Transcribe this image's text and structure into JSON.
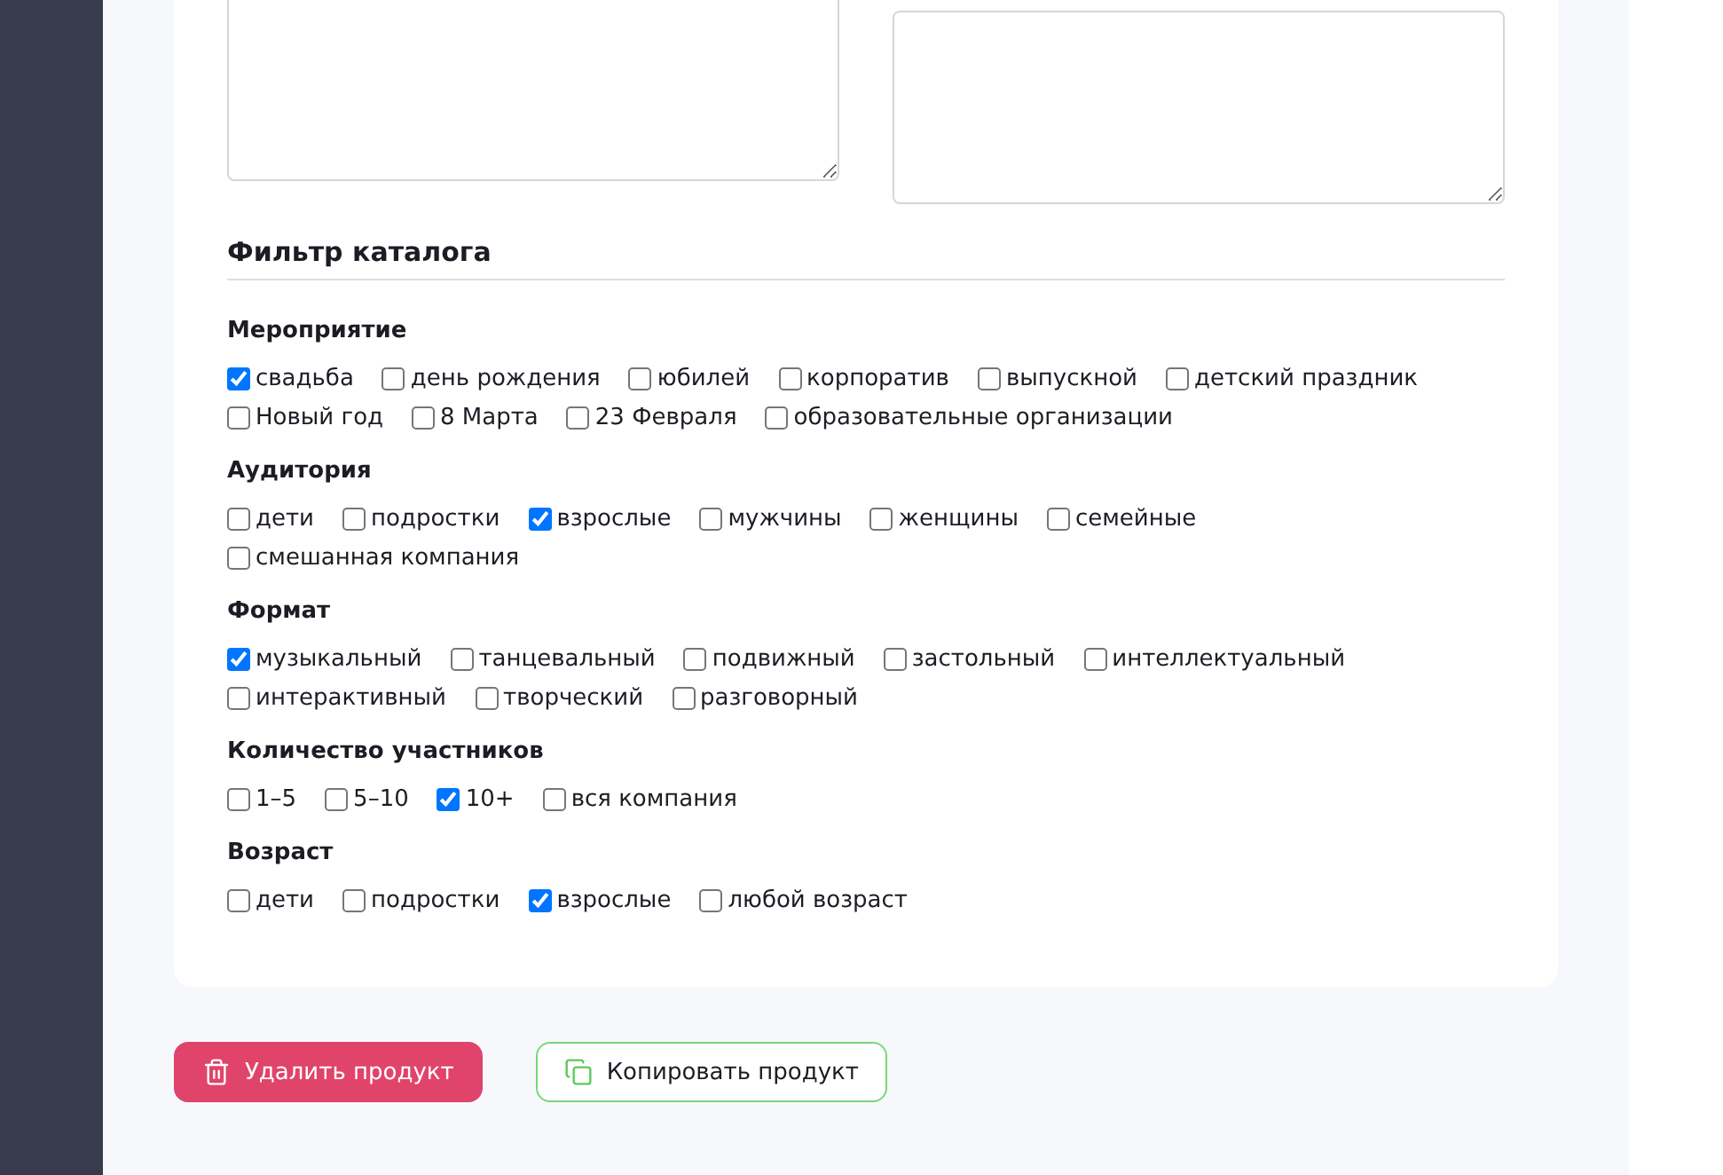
{
  "catalog_filter": {
    "title": "Фильтр каталога",
    "groups": [
      {
        "title": "Мероприятие",
        "options": [
          {
            "label": "свадьба",
            "checked": true
          },
          {
            "label": "день рождения",
            "checked": false
          },
          {
            "label": "юбилей",
            "checked": false
          },
          {
            "label": "корпоратив",
            "checked": false
          },
          {
            "label": "выпускной",
            "checked": false
          },
          {
            "label": "детский праздник",
            "checked": false
          },
          {
            "label": "Новый год",
            "checked": false
          },
          {
            "label": "8 Марта",
            "checked": false
          },
          {
            "label": "23 Февраля",
            "checked": false
          },
          {
            "label": "образовательные организации",
            "checked": false
          }
        ]
      },
      {
        "title": "Аудитория",
        "options": [
          {
            "label": "дети",
            "checked": false
          },
          {
            "label": "подростки",
            "checked": false
          },
          {
            "label": "взрослые",
            "checked": true
          },
          {
            "label": "мужчины",
            "checked": false
          },
          {
            "label": "женщины",
            "checked": false
          },
          {
            "label": "семейные",
            "checked": false
          },
          {
            "label": "смешанная компания",
            "checked": false
          }
        ]
      },
      {
        "title": "Формат",
        "options": [
          {
            "label": "музыкальный",
            "checked": true
          },
          {
            "label": "танцевальный",
            "checked": false
          },
          {
            "label": "подвижный",
            "checked": false
          },
          {
            "label": "застольный",
            "checked": false
          },
          {
            "label": "интеллектуальный",
            "checked": false
          },
          {
            "label": "интерактивный",
            "checked": false
          },
          {
            "label": "творческий",
            "checked": false
          },
          {
            "label": "разговорный",
            "checked": false
          }
        ]
      },
      {
        "title": "Количество участников",
        "options": [
          {
            "label": "1–5",
            "checked": false
          },
          {
            "label": "5–10",
            "checked": false
          },
          {
            "label": "10+",
            "checked": true
          },
          {
            "label": "вся компания",
            "checked": false
          }
        ]
      },
      {
        "title": "Возраст",
        "options": [
          {
            "label": "дети",
            "checked": false
          },
          {
            "label": "подростки",
            "checked": false
          },
          {
            "label": "взрослые",
            "checked": true
          },
          {
            "label": "любой возраст",
            "checked": false
          }
        ]
      }
    ]
  },
  "actions": [
    {
      "kind": "delete",
      "label": "Удалить продукт"
    },
    {
      "kind": "copy",
      "label": "Копировать продукт"
    }
  ]
}
